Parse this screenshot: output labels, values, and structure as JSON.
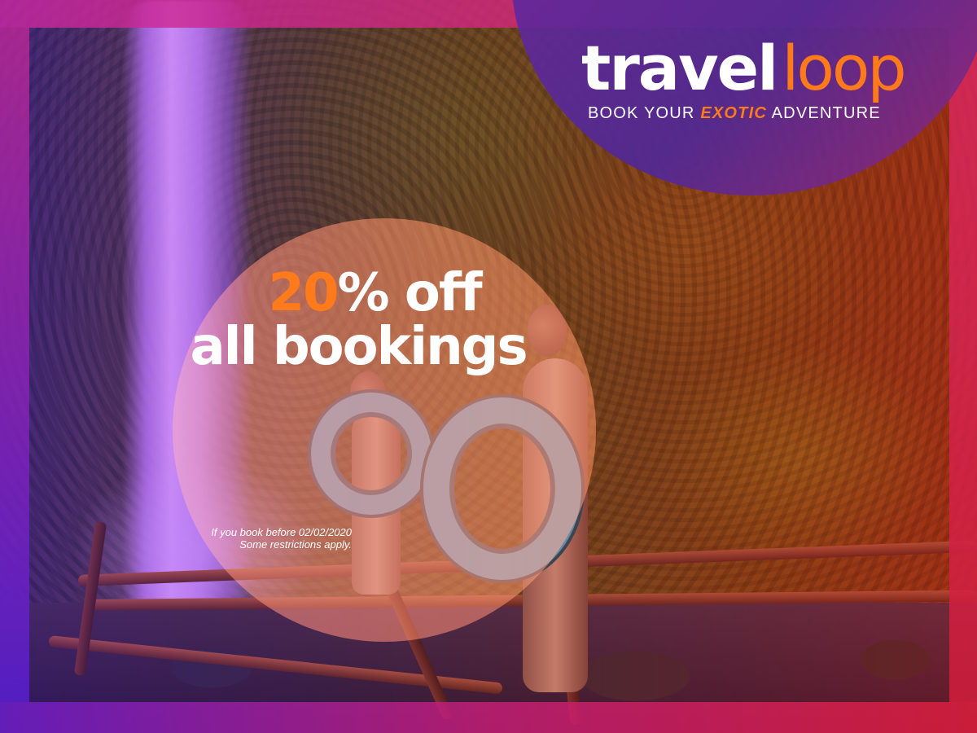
{
  "brand": {
    "name_part1": "travel",
    "name_part2": "loop",
    "tagline_before": "BOOK YOUR ",
    "tagline_highlight": "EXOTIC",
    "tagline_after": " ADVENTURE"
  },
  "offer": {
    "discount_number": "20",
    "discount_rest": "% off",
    "line2": "all bookings",
    "fineprint_line1": "If you book before 02/02/2020",
    "fineprint_line2": "Some restrictions apply."
  },
  "colors": {
    "accent": "#ff7a1a",
    "text": "#ffffff",
    "purple": "#5a2aa0",
    "magenta": "#c8288c",
    "red": "#dc2840"
  },
  "photo": {
    "subject": "waterfall-and-people-with-tubes-photo"
  }
}
